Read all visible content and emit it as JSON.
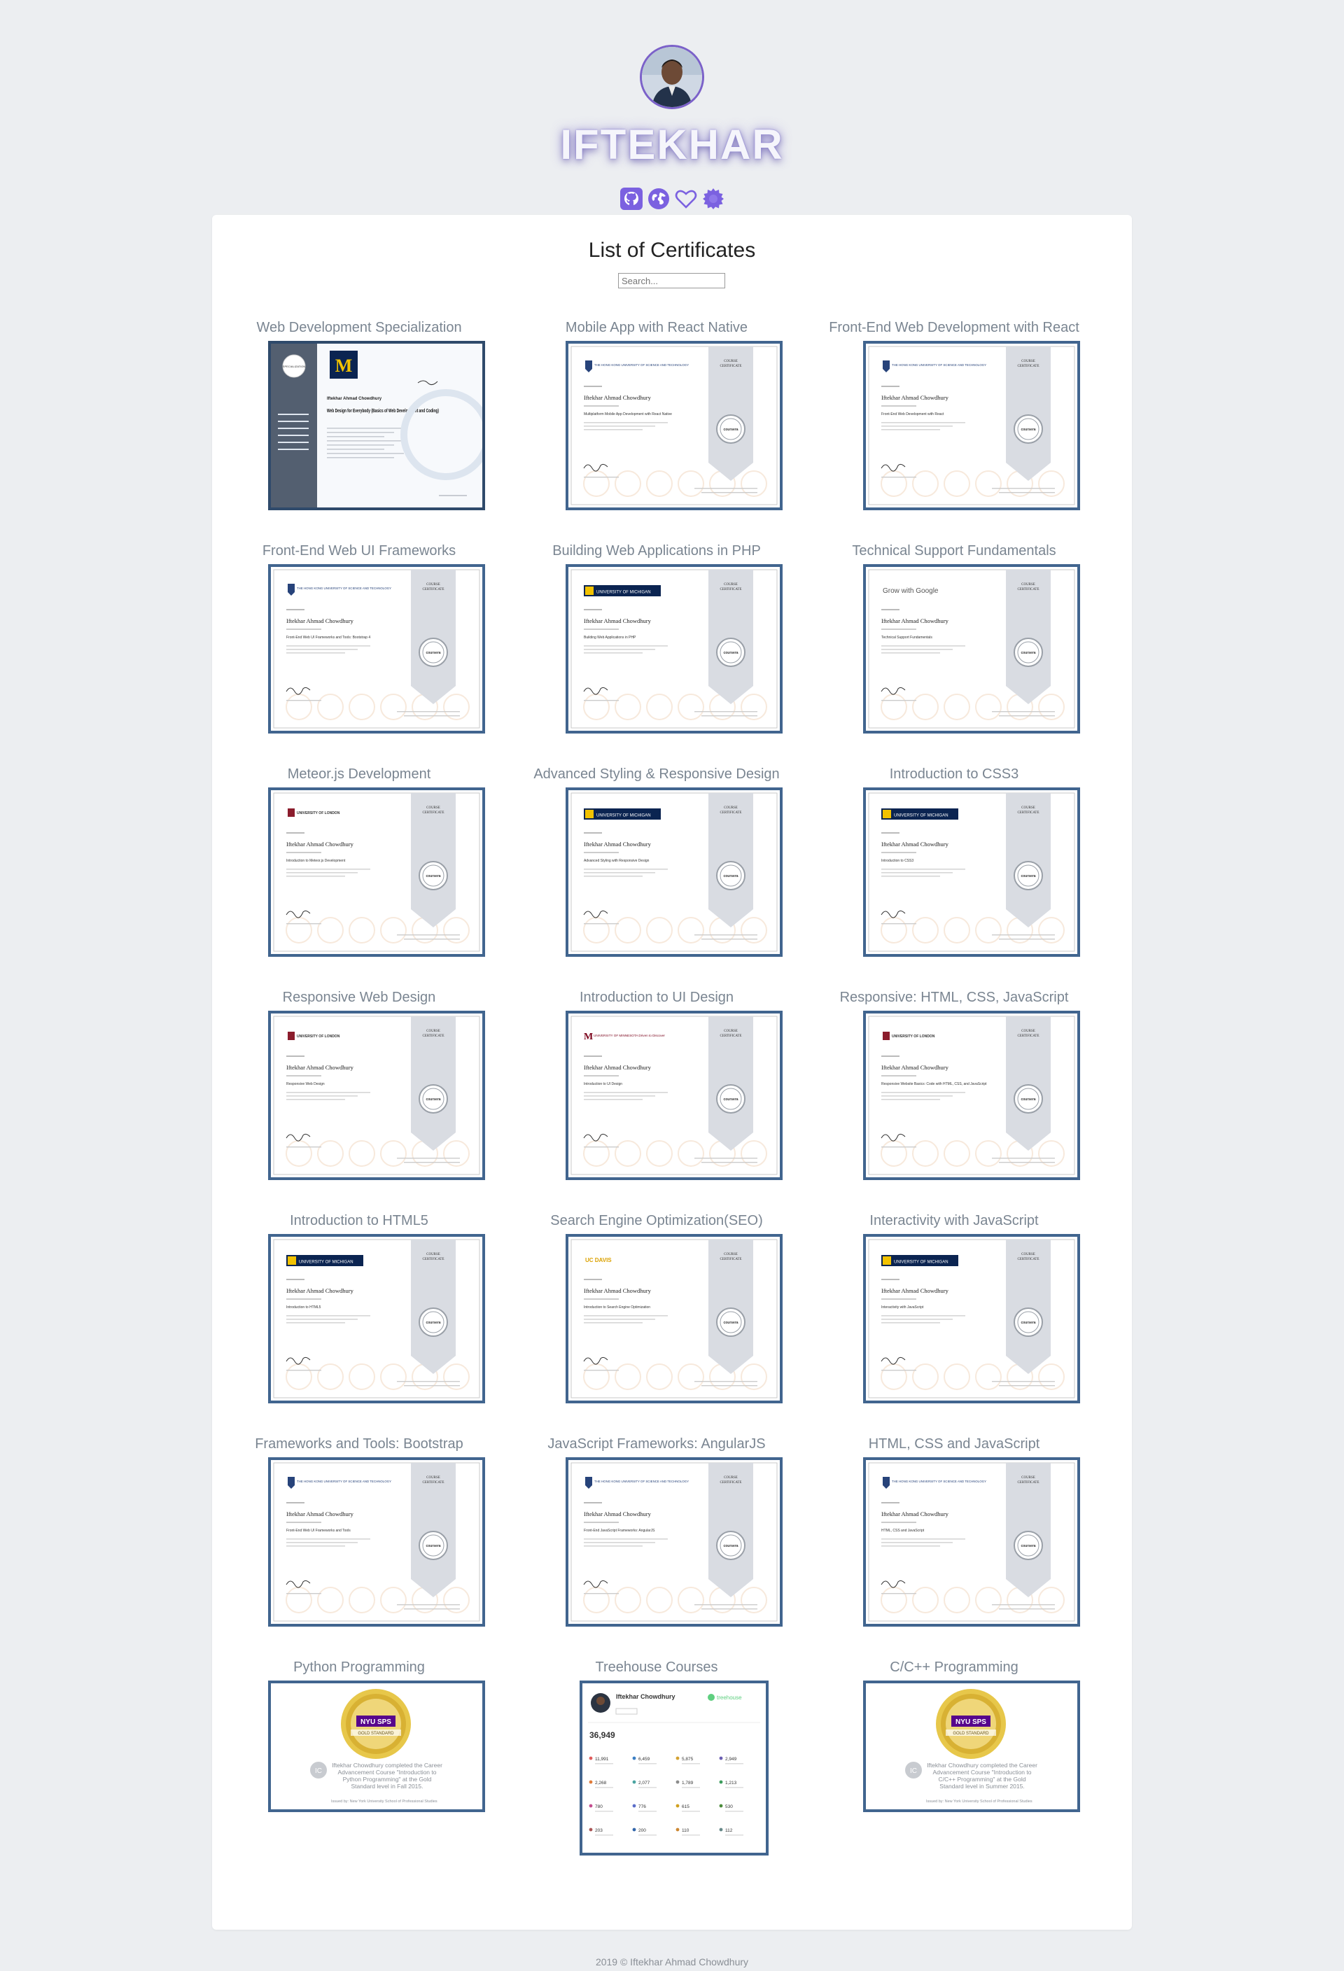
{
  "profile": {
    "name": "IFTEKHAR",
    "social": [
      {
        "icon": "github-icon",
        "color": "#7b61e0"
      },
      {
        "icon": "globe-icon",
        "color": "#7b61e0"
      },
      {
        "icon": "heart-icon",
        "color": "#7b61e0"
      },
      {
        "icon": "badge-icon",
        "color": "#7b61e0"
      }
    ]
  },
  "page": {
    "title": "List of Certificates",
    "search_placeholder": "Search..."
  },
  "certificates": [
    {
      "title": "Web Development Specialization",
      "style": "specialization",
      "recipient": "Iftekhar Ahmad Chowdhury",
      "course": "Web Design for Everybody (Basics of Web Development and Coding)"
    },
    {
      "title": "Mobile App with React Native",
      "style": "hkust",
      "recipient": "Iftekhar Ahmad Chowdhury",
      "course": "Multiplatform Mobile App Development with React Native",
      "logo": "THE HONG KONG UNIVERSITY OF SCIENCE AND TECHNOLOGY"
    },
    {
      "title": "Front-End Web Development with React",
      "style": "hkust",
      "recipient": "Iftekhar Ahmad Chowdhury",
      "course": "Front-End Web Development with React",
      "logo": "THE HONG KONG UNIVERSITY OF SCIENCE AND TECHNOLOGY"
    },
    {
      "title": "Front-End Web UI Frameworks",
      "style": "hkust",
      "recipient": "Iftekhar Ahmad Chowdhury",
      "course": "Front-End Web UI Frameworks and Tools: Bootstrap 4",
      "logo": "THE HONG KONG UNIVERSITY OF SCIENCE AND TECHNOLOGY"
    },
    {
      "title": "Building Web Applications in PHP",
      "style": "umich",
      "recipient": "Iftekhar Ahmad Chowdhury",
      "course": "Building Web Applications in PHP",
      "logo": "UNIVERSITY OF MICHIGAN"
    },
    {
      "title": "Technical Support Fundamentals",
      "style": "google",
      "recipient": "Iftekhar Ahmad Chowdhury",
      "course": "Technical Support Fundamentals",
      "logo": "Grow with Google"
    },
    {
      "title": "Meteor.js Development",
      "style": "london",
      "recipient": "Iftekhar Ahmad Chowdhury",
      "course": "Introduction to Meteor.js Development",
      "logo": "UNIVERSITY OF LONDON"
    },
    {
      "title": "Advanced Styling & Responsive Design",
      "style": "umich",
      "recipient": "Iftekhar Ahmad Chowdhury",
      "course": "Advanced Styling with Responsive Design",
      "logo": "UNIVERSITY OF MICHIGAN"
    },
    {
      "title": "Introduction to CSS3",
      "style": "umich",
      "recipient": "Iftekhar Ahmad Chowdhury",
      "course": "Introduction to CSS3",
      "logo": "UNIVERSITY OF MICHIGAN"
    },
    {
      "title": "Responsive Web Design",
      "style": "london",
      "recipient": "Iftekhar Ahmad Chowdhury",
      "course": "Responsive Web Design",
      "logo": "UNIVERSITY OF LONDON"
    },
    {
      "title": "Introduction to UI Design",
      "style": "minnesota",
      "recipient": "Iftekhar Ahmad Chowdhury",
      "course": "Introduction to UI Design",
      "logo": "UNIVERSITY OF MINNESOTA Driven to Discover"
    },
    {
      "title": "Responsive: HTML, CSS, JavaScript",
      "style": "london",
      "recipient": "Iftekhar Ahmad Chowdhury",
      "course": "Responsive Website Basics: Code with HTML, CSS, and JavaScript",
      "logo": "UNIVERSITY OF LONDON"
    },
    {
      "title": "Introduction to HTML5",
      "style": "umich",
      "recipient": "Iftekhar Ahmad Chowdhury",
      "course": "Introduction to HTML5",
      "logo": "UNIVERSITY OF MICHIGAN"
    },
    {
      "title": "Search Engine Optimization(SEO)",
      "style": "ucdavis",
      "recipient": "Iftekhar Ahmad Chowdhury",
      "course": "Introduction to Search Engine Optimization",
      "logo": "UC DAVIS"
    },
    {
      "title": "Interactivity with JavaScript",
      "style": "umich",
      "recipient": "Iftekhar Ahmad Chowdhury",
      "course": "Interactivity with JavaScript",
      "logo": "UNIVERSITY OF MICHIGAN"
    },
    {
      "title": "Frameworks and Tools: Bootstrap",
      "style": "hkust",
      "recipient": "Iftekhar Ahmad Chowdhury",
      "course": "Front-End Web UI Frameworks and Tools",
      "logo": "THE HONG KONG UNIVERSITY OF SCIENCE AND TECHNOLOGY"
    },
    {
      "title": "JavaScript Frameworks: AngularJS",
      "style": "hkust",
      "recipient": "Iftekhar Ahmad Chowdhury",
      "course": "Front-End JavaScript Frameworks: AngularJS",
      "logo": "THE HONG KONG UNIVERSITY OF SCIENCE AND TECHNOLOGY"
    },
    {
      "title": "HTML, CSS and JavaScript",
      "style": "hkust",
      "recipient": "Iftekhar Ahmad Chowdhury",
      "course": "HTML, CSS and JavaScript",
      "logo": "THE HONG KONG UNIVERSITY OF SCIENCE AND TECHNOLOGY"
    },
    {
      "title": "Python Programming",
      "style": "nyu",
      "badge_text": "NYU SPS",
      "badge_sub": "GOLD STANDARD",
      "note": "Iftekhar Chowdhury completed the Career Advancement Course \"Introduction to Python Programming\" at the Gold Standard level in Fall 2015.",
      "issuer": "Issued by: New York University School of Professional Studies"
    },
    {
      "title": "Treehouse Courses",
      "style": "treehouse",
      "name": "Iftekhar Chowdhury",
      "brand": "treehouse",
      "points": "36,949",
      "stats": [
        "11,991",
        "6,459",
        "5,875",
        "2,949",
        "2,268",
        "2,077",
        "1,789",
        "1,213",
        "780",
        "776",
        "615",
        "530",
        "203",
        "200",
        "110",
        "112"
      ]
    },
    {
      "title": "C/C++ Programming",
      "style": "nyu",
      "badge_text": "NYU SPS",
      "badge_sub": "GOLD STANDARD",
      "note": "Iftekhar Chowdhury completed the Career Advancement Course \"Introduction to C/C++ Programming\" at the Gold Standard level in Summer 2015.",
      "issuer": "Issued by: New York University School of Professional Studies"
    }
  ],
  "footer": {
    "text": "2019 © Iftekhar Ahmad Chowdhury"
  }
}
